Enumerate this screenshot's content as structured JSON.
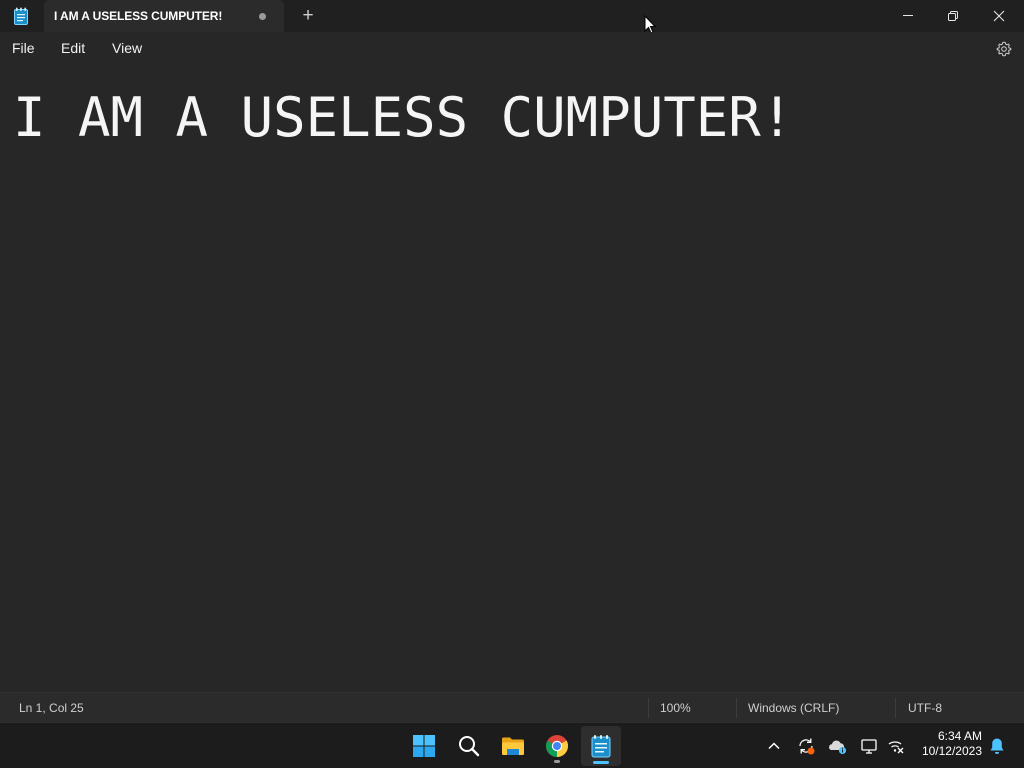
{
  "window": {
    "tab_title": "I AM A USELESS CUMPUTER!",
    "new_tab_symbol": "+",
    "unsaved_indicator": "modified-dot"
  },
  "menu": {
    "items": [
      {
        "label": "File"
      },
      {
        "label": "Edit"
      },
      {
        "label": "View"
      }
    ],
    "settings_icon": "gear-icon"
  },
  "editor": {
    "content": "I AM A USELESS CUMPUTER!"
  },
  "status": {
    "position": "Ln 1, Col 25",
    "zoom": "100%",
    "line_ending": "Windows (CRLF)",
    "encoding": "UTF-8"
  },
  "taskbar": {
    "apps": [
      "start-icon",
      "search-icon",
      "file-explorer-icon",
      "chrome-icon",
      "notepad-icon"
    ],
    "active_app": "notepad-icon",
    "tray_icons": [
      "chevron-up-icon",
      "sync-icon",
      "onedrive-icon",
      "display-icon",
      "network-off-icon"
    ],
    "time": "6:34 AM",
    "date": "10/12/2023"
  },
  "colors": {
    "background": "#272727",
    "titlebar": "#202020",
    "taskbar": "#1c1c1c",
    "accent": "#4cc2ff"
  }
}
